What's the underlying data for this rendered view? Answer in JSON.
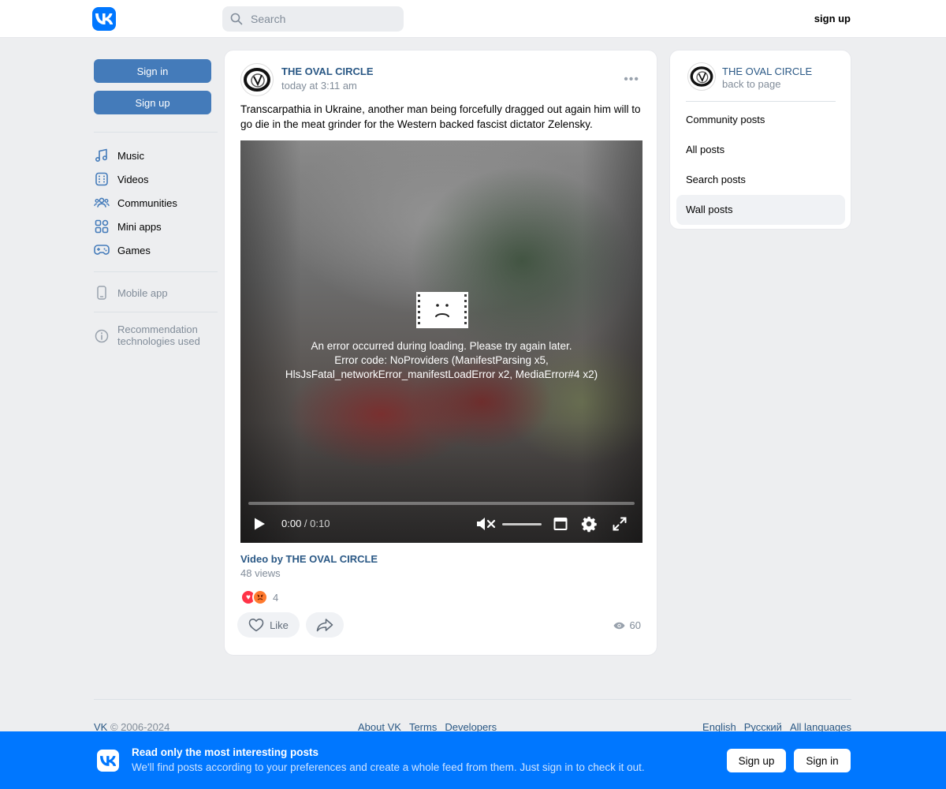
{
  "header": {
    "search_placeholder": "Search",
    "signup_link": "sign up"
  },
  "leftnav": {
    "signin_button": "Sign in",
    "signup_button": "Sign up",
    "items": [
      {
        "label": "Music",
        "icon": "music-icon"
      },
      {
        "label": "Videos",
        "icon": "videos-icon"
      },
      {
        "label": "Communities",
        "icon": "communities-icon"
      },
      {
        "label": "Mini apps",
        "icon": "mini-apps-icon"
      },
      {
        "label": "Games",
        "icon": "games-icon"
      }
    ],
    "mobile_app": "Mobile app",
    "recommendation_line1": "Recommendation",
    "recommendation_line2": "technologies used"
  },
  "post": {
    "author": "THE OVAL CIRCLE",
    "time": "today at 3:11 am",
    "more": "•••",
    "text": "Transcarpathia in Ukraine, another man being forcefully dragged out again him will to go die in the meat grinder for the Western backed fascist dictator Zelensky.",
    "video": {
      "error_line1": "An error occurred during loading. Please try again later.",
      "error_line2": "Error code: NoProviders (ManifestParsing x5,",
      "error_line3": "HlsJsFatal_networkError_manifestLoadError x2, MediaError#4 x2)",
      "time_current": "0:00",
      "time_separator": " / ",
      "time_total": "0:10",
      "progress": 0
    },
    "video_title": "Video by THE OVAL CIRCLE",
    "video_views": "48 views",
    "reactions_count": "4",
    "like_label": "Like",
    "views": "60"
  },
  "side": {
    "name": "THE OVAL CIRCLE",
    "back": "back to page",
    "menu": [
      "Community posts",
      "All posts",
      "Search posts",
      "Wall posts"
    ],
    "active_index": 3
  },
  "footer": {
    "brand": "VK",
    "copyright": " © 2006-2024",
    "links": [
      "About VK",
      "Terms",
      "Developers"
    ],
    "languages": [
      "English",
      "Русский",
      "All languages"
    ]
  },
  "banner": {
    "title": "Read only the most interesting posts",
    "subtitle": "We'll find posts according to your preferences and create a whole feed from them. Just sign in to check it out.",
    "signup": "Sign up",
    "signin": "Sign in"
  },
  "colors": {
    "brand": "#0077ff",
    "button": "#447bba",
    "link": "#2a5885",
    "muted": "#818c99"
  }
}
